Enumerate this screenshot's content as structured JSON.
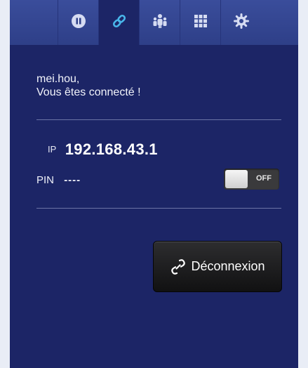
{
  "toolbar": {
    "items": [
      {
        "name": "pause",
        "icon": "pause-circle-icon"
      },
      {
        "name": "link",
        "icon": "link-icon",
        "active": true
      },
      {
        "name": "users",
        "icon": "users-icon"
      },
      {
        "name": "grid",
        "icon": "grid-icon"
      },
      {
        "name": "settings",
        "icon": "gear-icon"
      }
    ]
  },
  "greeting": {
    "user": "mei.hou,",
    "message": "Vous êtes connecté !"
  },
  "connection": {
    "ip_label": "IP",
    "ip_value": "192.168.43.1",
    "pin_label": "PIN",
    "pin_value": "----",
    "pin_toggle": {
      "state": "OFF"
    }
  },
  "actions": {
    "disconnect_label": "Déconnexion"
  },
  "colors": {
    "background": "#1c2566",
    "toolbar": "#33458f",
    "accent": "#49b6ea"
  }
}
